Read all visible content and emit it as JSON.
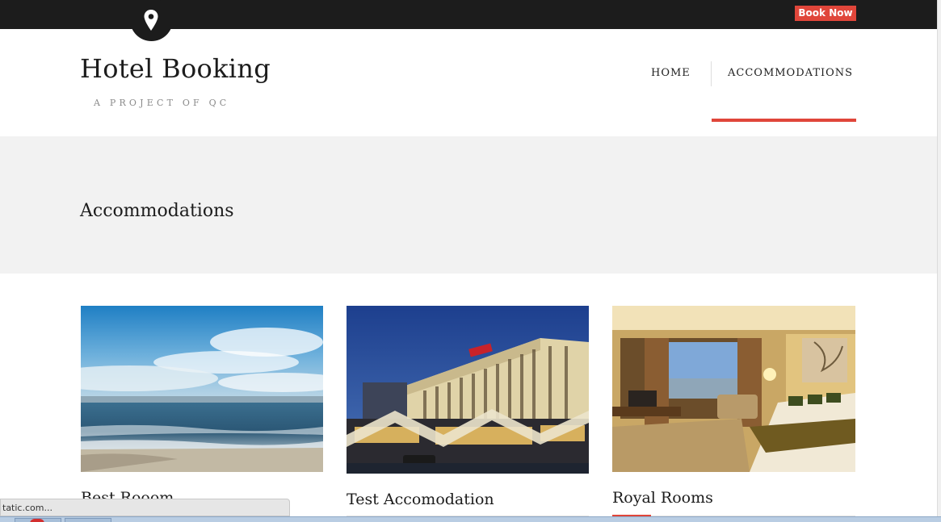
{
  "topbar": {
    "book_now_label": "Book Now",
    "location_icon": "map-pin-icon"
  },
  "header": {
    "site_title": "Hotel Booking",
    "tagline": "A PROJECT OF QC"
  },
  "nav": {
    "items": [
      {
        "label": "HOME"
      },
      {
        "label": "ACCOMMODATIONS",
        "active": true
      }
    ]
  },
  "page": {
    "title": "Accommodations"
  },
  "accommodations": [
    {
      "title": "Best Rooom",
      "image": "ocean-beach-photo"
    },
    {
      "title": "Test Accomodation",
      "image": "hotel-night-photo"
    },
    {
      "title": "Royal Rooms",
      "image": "hotel-room-photo"
    }
  ],
  "status_bar": {
    "url_text": "tatic.com..."
  },
  "colors": {
    "accent": "#e0463a",
    "topbar": "#1c1c1c",
    "banner": "#f2f2f2"
  }
}
